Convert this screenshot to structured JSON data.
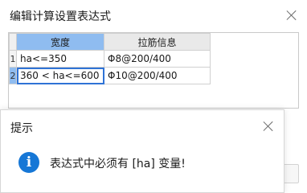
{
  "main_dialog": {
    "title": "编辑计算设置表达式"
  },
  "table": {
    "columns": [
      "宽度",
      "拉筋信息"
    ],
    "rows": [
      {
        "num": "1",
        "width": "ha<=350",
        "tie": "Φ8@200/400"
      },
      {
        "num": "2",
        "width": "360 < ha<=600",
        "tie": "Φ10@200/400"
      }
    ]
  },
  "alert": {
    "title": "提示",
    "message": "表达式中必须有 [ha] 变量!",
    "icon": "info-icon"
  }
}
